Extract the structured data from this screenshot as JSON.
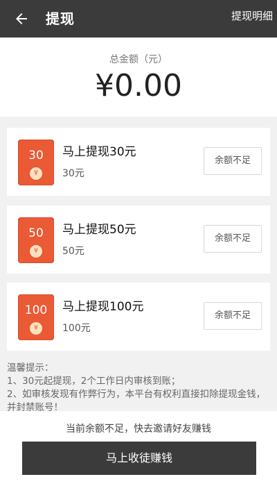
{
  "header": {
    "title": "提现",
    "detail_link": "提现明细"
  },
  "total": {
    "label": "总金额（元）",
    "amount": "¥0.00"
  },
  "options": [
    {
      "badge": "30",
      "title": "马上提现30元",
      "sub": "30元",
      "button": "余额不足"
    },
    {
      "badge": "50",
      "title": "马上提现50元",
      "sub": "50元",
      "button": "余额不足"
    },
    {
      "badge": "100",
      "title": "马上提现100元",
      "sub": "100元",
      "button": "余额不足"
    }
  ],
  "coin_symbol": "¥",
  "tips": {
    "heading": "温馨提示：",
    "lines": [
      "1、30元起提现，2个工作日内审核到账；",
      "2、如审核发现有作弊行为，本平台有权利直接扣除提现金钱，并封禁账号！"
    ]
  },
  "bottom": {
    "notice": "当前余额不足，快去邀请好友赚钱",
    "button": "马上收徒赚钱"
  },
  "colors": {
    "header_bg": "#3b3b3b",
    "badge_bg": "#e95a35",
    "page_bg": "#f1f1f1"
  },
  "icons": {
    "back": "arrow-left-icon",
    "coin": "yuan-coin-icon"
  }
}
